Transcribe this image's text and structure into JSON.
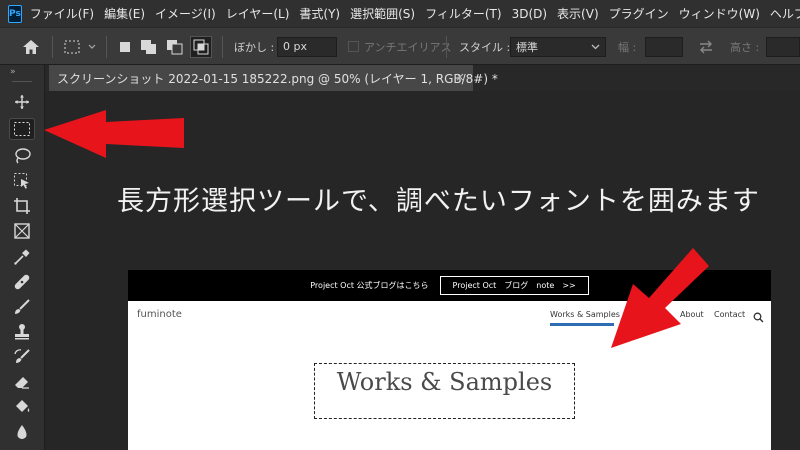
{
  "app": {
    "logo": "Ps"
  },
  "menu": [
    "ファイル(F)",
    "編集(E)",
    "イメージ(I)",
    "レイヤー(L)",
    "書式(Y)",
    "選択範囲(S)",
    "フィルター(T)",
    "3D(D)",
    "表示(V)",
    "プラグイン",
    "ウィンドウ(W)",
    "ヘルプ(H)"
  ],
  "options": {
    "feather_label": "ぼかし :",
    "feather_value": "0 px",
    "antialias_label": "アンチエイリアス",
    "style_label": "スタイル :",
    "style_value": "標準",
    "width_label": "幅 :",
    "height_label": "高さ :"
  },
  "tools": [
    "move-icon",
    "marquee-icon",
    "lasso-icon",
    "object-select-icon",
    "crop-icon",
    "frame-icon",
    "eyedropper-icon",
    "healing-icon",
    "brush-icon",
    "stamp-icon",
    "history-brush-icon",
    "eraser-icon",
    "paint-bucket-icon",
    "blur-icon"
  ],
  "active_tool": "marquee-icon",
  "document_tab": {
    "title": "スクリーンショット 2022-01-15 185222.png @ 50% (レイヤー 1, RGB/8#) *",
    "close": "×"
  },
  "canvas": {
    "headline": "長方形選択ツールで、調べたいフォントを囲みます",
    "site": {
      "topbar_text": "Project Oct 公式ブログはこちら",
      "topbar_button": "Project Oct　ブログ　note　>>",
      "brand": "fuminote",
      "nav": [
        "Works & Samples",
        "About",
        "Contact"
      ],
      "title": "Works & Samples"
    }
  },
  "colors": {
    "arrow": "#e8141c",
    "nav_underline": "#2e6db4",
    "ps_accent": "#31a8ff"
  }
}
